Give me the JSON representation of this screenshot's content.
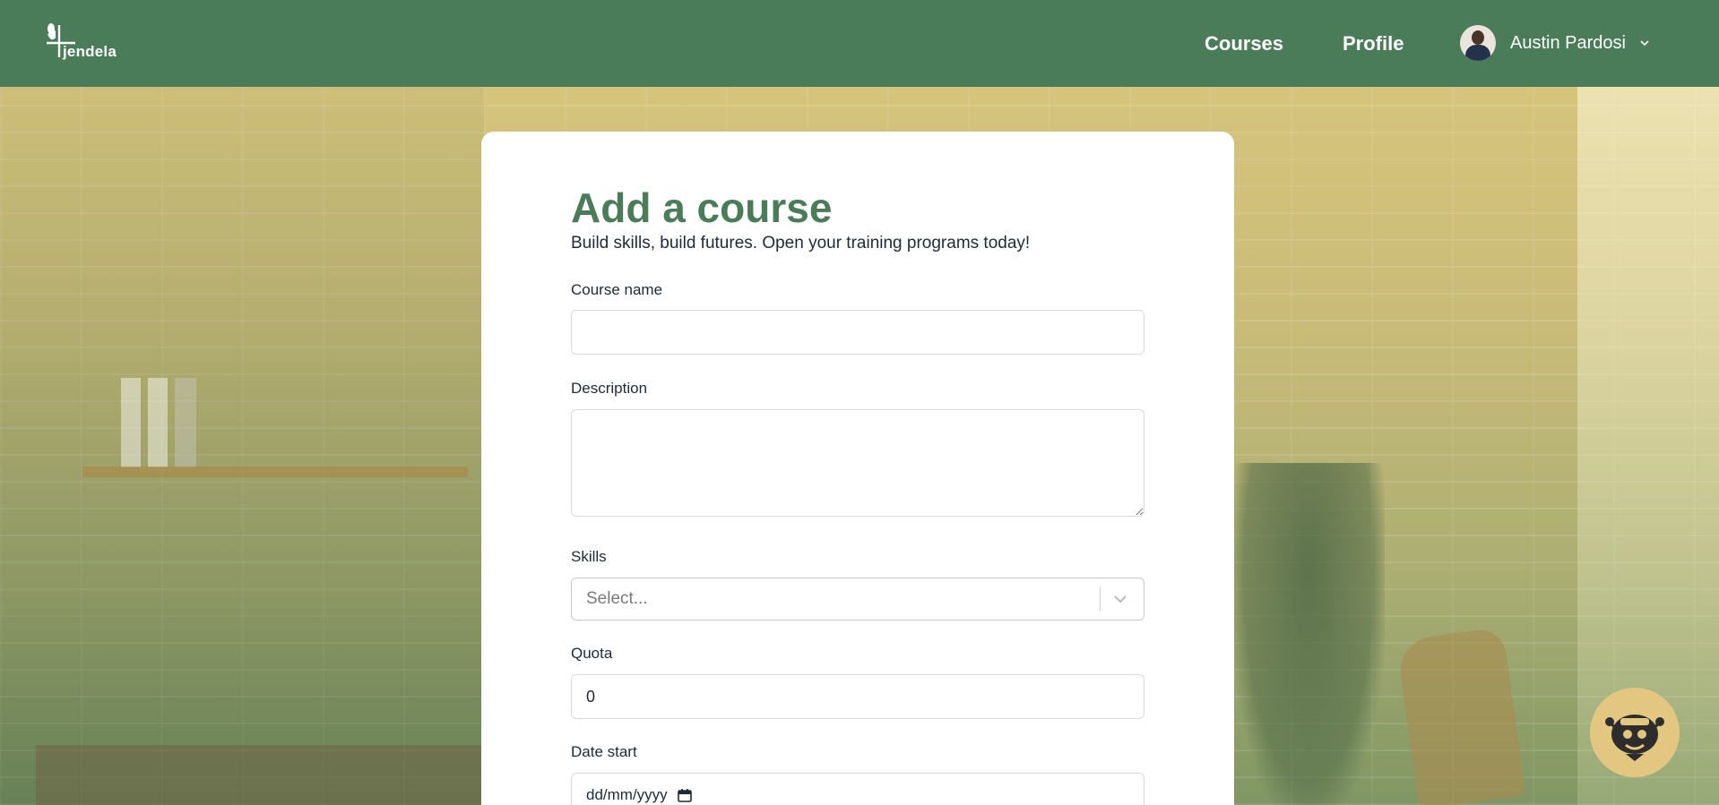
{
  "brand": {
    "name": "jendela"
  },
  "nav": {
    "courses": "Courses",
    "profile": "Profile"
  },
  "user": {
    "name": "Austin Pardosi"
  },
  "form": {
    "title": "Add a course",
    "subtitle": "Build skills, build futures. Open your training programs today!",
    "course_name": {
      "label": "Course name",
      "value": ""
    },
    "description": {
      "label": "Description",
      "value": ""
    },
    "skills": {
      "label": "Skills",
      "placeholder": "Select..."
    },
    "quota": {
      "label": "Quota",
      "value": "0"
    },
    "date_start": {
      "label": "Date start",
      "placeholder": "dd/mm/yyyy"
    }
  },
  "colors": {
    "header": "#4a7c59",
    "title": "#4a7c59",
    "bot": "#e3c780"
  },
  "icons": {
    "logo": "jendela-logo-icon",
    "dropdown": "chevron-down-icon",
    "calendar": "calendar-icon",
    "chatbot": "robot-icon"
  }
}
